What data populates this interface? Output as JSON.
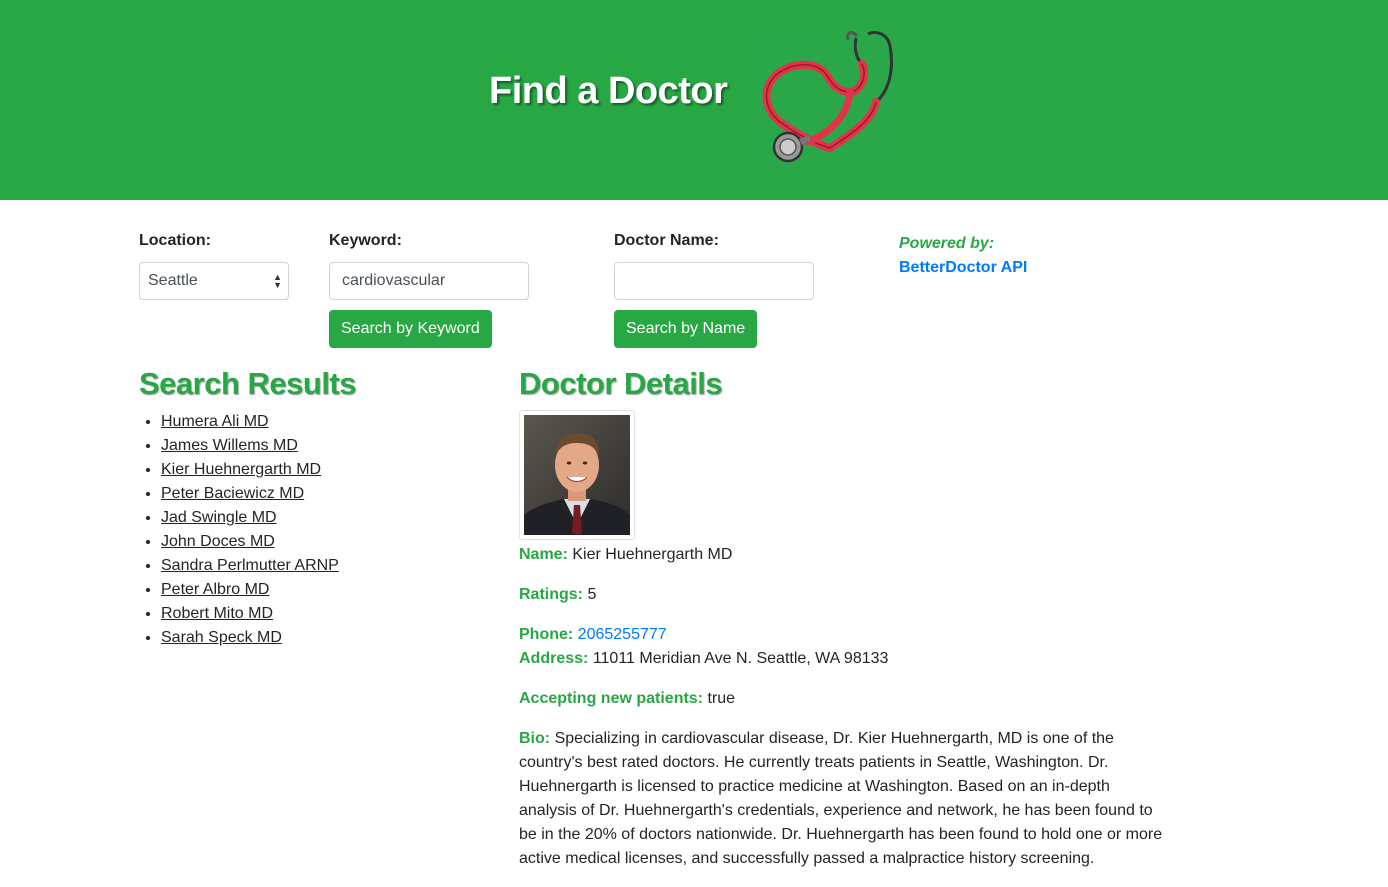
{
  "header": {
    "title": "Find a Doctor"
  },
  "search": {
    "location_label": "Location:",
    "location_value": "Seattle",
    "keyword_label": "Keyword:",
    "keyword_value": "cardiovascular",
    "keyword_button": "Search by Keyword",
    "name_label": "Doctor Name:",
    "name_value": "",
    "name_button": "Search by Name"
  },
  "powered": {
    "label": "Powered by:",
    "link": "BetterDoctor API"
  },
  "results": {
    "heading": "Search Results",
    "items": [
      "Humera Ali MD",
      "James Willems MD",
      "Kier Huehnergarth MD",
      "Peter Baciewicz MD",
      "Jad Swingle MD",
      "John Doces MD",
      "Sandra Perlmutter ARNP",
      "Peter Albro MD",
      "Robert Mito MD",
      "Sarah Speck MD"
    ]
  },
  "details": {
    "heading": "Doctor Details",
    "name_label": "Name:",
    "name": "Kier Huehnergarth MD",
    "ratings_label": "Ratings:",
    "ratings": "5",
    "phone_label": "Phone:",
    "phone": "2065255777",
    "address_label": "Address:",
    "address": "11011 Meridian Ave N. Seattle, WA 98133",
    "accepting_label": "Accepting new patients:",
    "accepting": "true",
    "bio_label": "Bio:",
    "bio": "Specializing in cardiovascular disease, Dr. Kier Huehnergarth, MD is one of the country's best rated doctors. He currently treats patients in Seattle, Washington. Dr. Huehnergarth is licensed to practice medicine at Washington. Based on an in-depth analysis of Dr. Huehnergarth's credentials, experience and network, he has been found to be in the 20% of doctors nationwide. Dr. Huehnergarth has been found to hold one or more active medical licenses, and successfully passed a malpractice history screening."
  },
  "colors": {
    "brand": "#28a745",
    "link": "#007bff",
    "stethoscope": "#e0344a"
  },
  "icons": {
    "logo": "stethoscope-heart-icon",
    "photo": "doctor-photo"
  }
}
